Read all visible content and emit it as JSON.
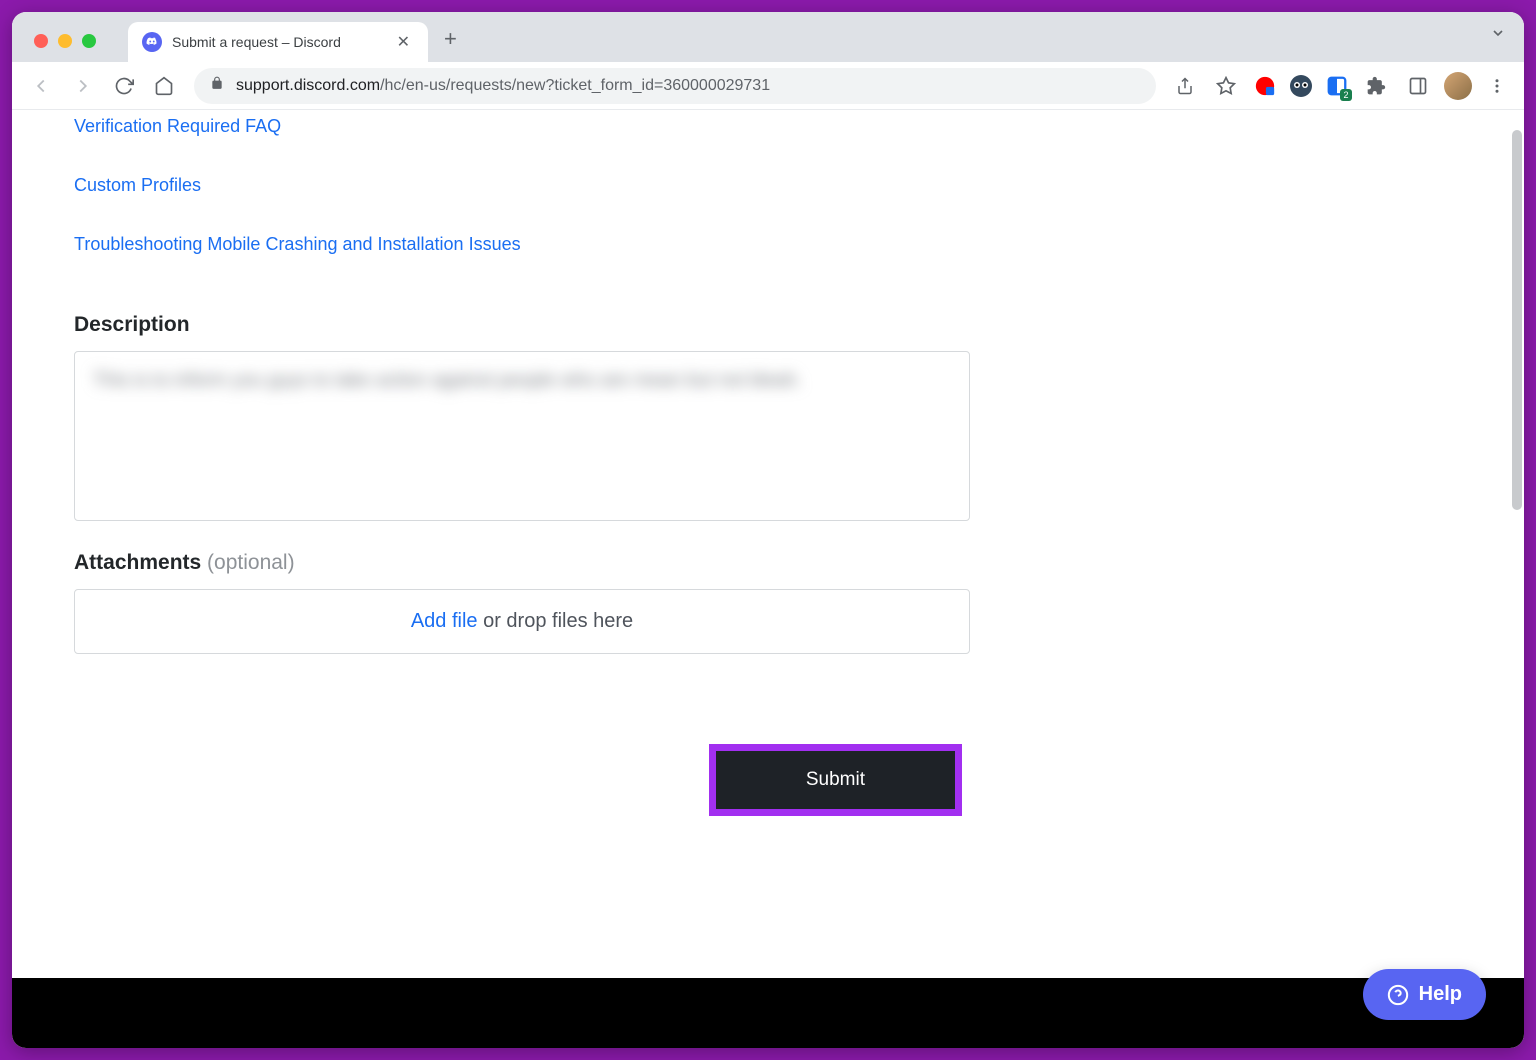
{
  "browser": {
    "tab_title": "Submit a request – Discord",
    "url_host": "support.discord.com",
    "url_path": "/hc/en-us/requests/new?ticket_form_id=360000029731",
    "extension_badge": "2"
  },
  "links": [
    "Verification Required FAQ",
    "Custom Profiles",
    "Troubleshooting Mobile Crashing and Installation Issues"
  ],
  "form": {
    "description_label": "Description",
    "description_value_blurred": "This is to inform you guys to take action against people who are mean but not bleah.",
    "attachments_label": "Attachments",
    "attachments_optional": "(optional)",
    "attach_add": "Add file",
    "attach_drop": " or drop files here",
    "submit_label": "Submit"
  },
  "help_widget": {
    "label": "Help"
  }
}
